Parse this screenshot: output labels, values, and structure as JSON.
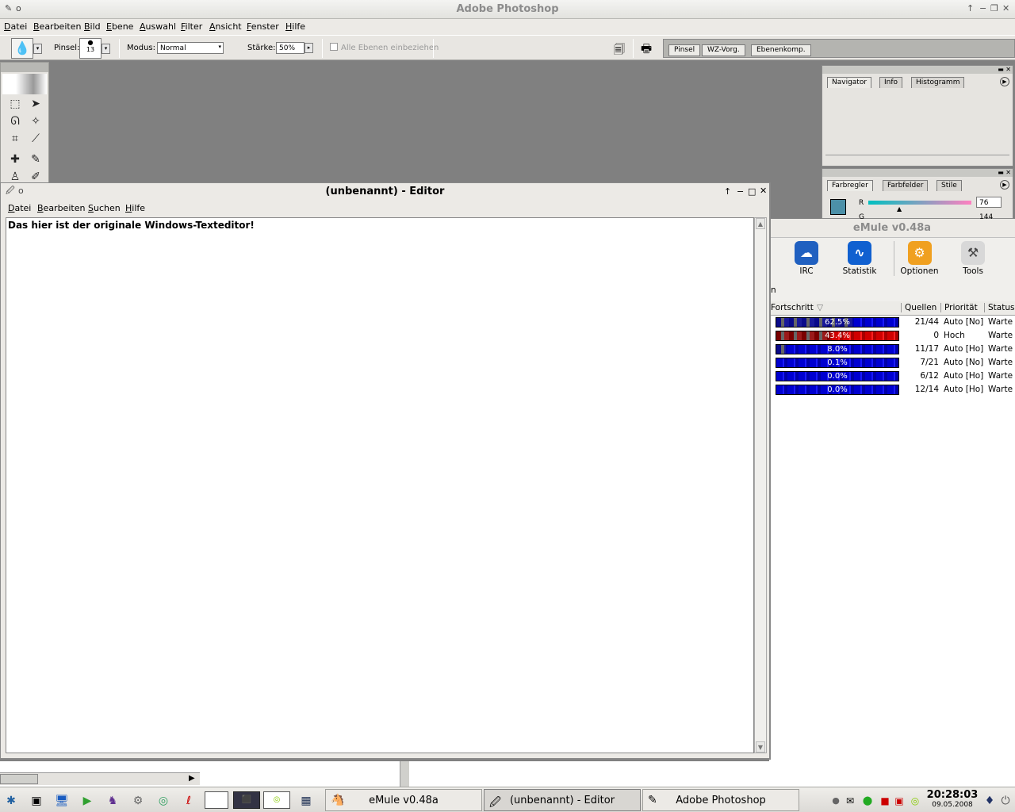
{
  "photoshop": {
    "title": "Adobe Photoshop",
    "menu": [
      "Datei",
      "Bearbeiten",
      "Bild",
      "Ebene",
      "Auswahl",
      "Filter",
      "Ansicht",
      "Fenster",
      "Hilfe"
    ],
    "options": {
      "brush_label": "Pinsel:",
      "brush_size": "13",
      "mode_label": "Modus:",
      "mode_value": "Normal",
      "strength_label": "Stärke:",
      "strength_value": "50%",
      "all_layers_label": "Alle Ebenen einbeziehen"
    },
    "palette_well_tabs": [
      "Pinsel",
      "WZ-Vorg.",
      "Ebenenkomp."
    ],
    "navigator_tabs": [
      "Navigator",
      "Info",
      "Histogramm"
    ],
    "color_tabs": [
      "Farbregler",
      "Farbfelder",
      "Stile"
    ],
    "color_r_label": "R",
    "color_r_value": "76",
    "color_g_label": "G",
    "color_g_value": "144"
  },
  "emule": {
    "title": "eMule v0.48a",
    "toolbar": [
      {
        "label": "IRC",
        "icon": "irc-icon"
      },
      {
        "label": "Statistik",
        "icon": "statistics-icon"
      },
      {
        "label": "Optionen",
        "icon": "options-gear-icon"
      },
      {
        "label": "Tools",
        "icon": "tools-icon"
      }
    ],
    "partial_label": "n",
    "columns": [
      "Fortschritt",
      "Quellen",
      "Priorität",
      "Status"
    ],
    "rows": [
      {
        "progress": "62.5%",
        "sources": "21/44",
        "priority": "Auto [No]",
        "status": "Warte"
      },
      {
        "progress": "43.4%",
        "sources": "0",
        "priority": "Hoch",
        "status": "Warte"
      },
      {
        "progress": "8.0%",
        "sources": "11/17",
        "priority": "Auto [Ho]",
        "status": "Warte"
      },
      {
        "progress": "0.1%",
        "sources": "7/21",
        "priority": "Auto [No]",
        "status": "Warte"
      },
      {
        "progress": "0.0%",
        "sources": "6/12",
        "priority": "Auto [Ho]",
        "status": "Warte"
      },
      {
        "progress": "0.0%",
        "sources": "12/14",
        "priority": "Auto [Ho]",
        "status": "Warte"
      }
    ],
    "progress_fill": [
      0.625,
      0.434,
      0.08,
      0.001,
      0.0,
      0.0
    ],
    "colors": {
      "bar_blue": "#0000d0",
      "bar_red": "#d00000"
    }
  },
  "editor": {
    "title": "(unbenannt) - Editor",
    "menu": [
      "Datei",
      "Bearbeiten",
      "Suchen",
      "Hilfe"
    ],
    "text": "Das hier ist der originale Windows-Texteditor!"
  },
  "taskbar": {
    "tasks": [
      {
        "label": "eMule v0.48a",
        "icon": "emule-icon"
      },
      {
        "label": "(unbenannt) - Editor",
        "icon": "editor-icon"
      },
      {
        "label": "Adobe Photoshop",
        "icon": "photoshop-icon"
      }
    ],
    "clock_time": "20:28:03",
    "clock_date": "09.05.2008"
  }
}
